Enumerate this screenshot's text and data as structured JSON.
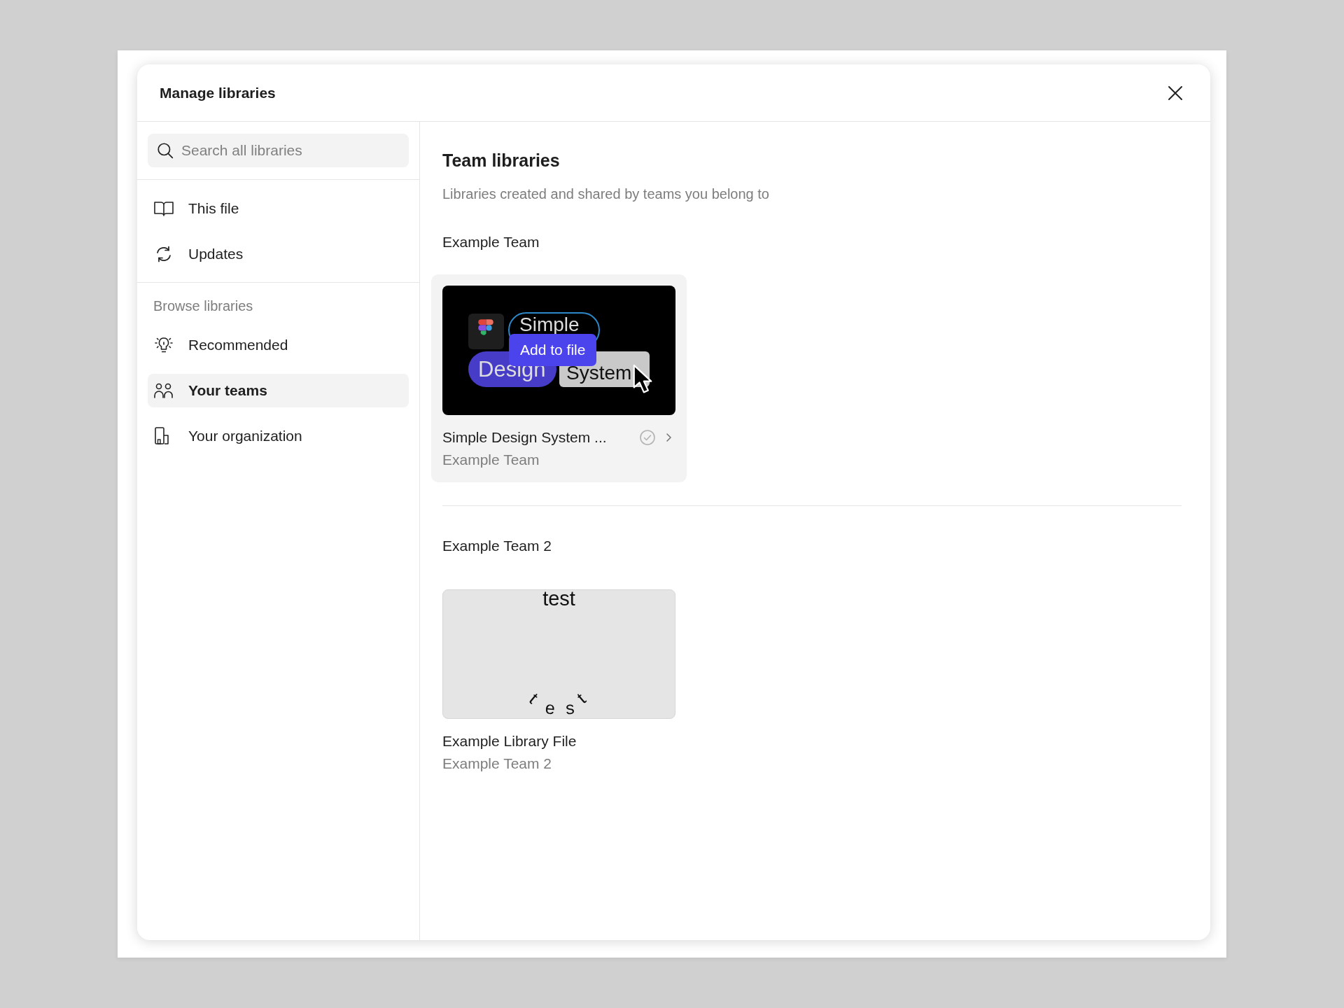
{
  "dialog": {
    "title": "Manage libraries"
  },
  "search": {
    "placeholder": "Search all libraries"
  },
  "nav_items": [
    {
      "label": "This file",
      "selected": false
    },
    {
      "label": "Updates",
      "selected": false
    }
  ],
  "browse": {
    "heading": "Browse libraries",
    "items": [
      {
        "label": "Recommended",
        "selected": false
      },
      {
        "label": "Your teams",
        "selected": true
      },
      {
        "label": "Your organization",
        "selected": false
      }
    ]
  },
  "content": {
    "title": "Team libraries",
    "subtitle": "Libraries created and shared by teams you belong to",
    "teams": [
      {
        "name": "Example Team",
        "libraries": [
          {
            "name": "Simple Design System ...",
            "team": "Example Team",
            "hovered": true,
            "action": "Add to file",
            "thumbnail": {
              "kind": "design-system",
              "texts": [
                "Simple",
                "Design",
                "System"
              ]
            }
          }
        ]
      },
      {
        "name": "Example Team 2",
        "libraries": [
          {
            "name": "Example Library File",
            "team": "Example Team 2",
            "hovered": false,
            "thumbnail": {
              "kind": "text-arc",
              "top_text": "test",
              "arc_text": "t e s t"
            }
          }
        ]
      }
    ]
  }
}
